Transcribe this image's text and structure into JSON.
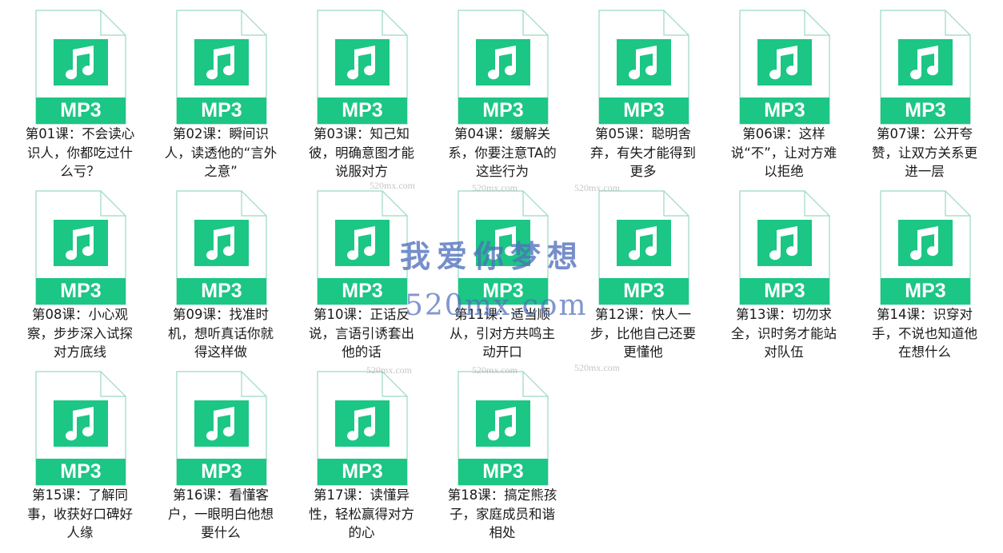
{
  "file_type_label": "MP3",
  "colors": {
    "accent": "#1cc685",
    "border": "#9ad9c0",
    "page_fill": "#ffffff"
  },
  "icon_name": "music-note-icon",
  "files": [
    {
      "name": "第01课：不会读心识人，你都吃过什么亏？"
    },
    {
      "name": "第02课：瞬间识人，读透他的“言外之意”"
    },
    {
      "name": "第03课：知己知彼，明确意图才能说服对方"
    },
    {
      "name": "第04课：缓解关系，你要注意TA的这些行为"
    },
    {
      "name": "第05课：聪明舍弃，有失才能得到更多"
    },
    {
      "name": "第06课：这样说“不”，让对方难以拒绝"
    },
    {
      "name": "第07课：公开夸赞，让双方关系更进一层"
    },
    {
      "name": "第08课：小心观察，步步深入试探对方底线"
    },
    {
      "name": "第09课：找准时机，想听真话你就得这样做"
    },
    {
      "name": "第10课：正话反说，言语引诱套出他的话"
    },
    {
      "name": "第11课：适当顺从，引对方共鸣主动开口"
    },
    {
      "name": "第12课：快人一步，比他自己还要更懂他"
    },
    {
      "name": "第13课：切勿求全，识时务才能站对队伍"
    },
    {
      "name": "第14课：识穿对手，不说也知道他在想什么"
    },
    {
      "name": "第15课：了解同事，收获好口碑好人缘"
    },
    {
      "name": "第16课：看懂客户，一眼明白他想要什么"
    },
    {
      "name": "第17课：读懂异性，轻松赢得对方的心"
    },
    {
      "name": "第18课：搞定熊孩子，家庭成员和谐相处"
    }
  ],
  "watermark": {
    "main": "我爱你梦想",
    "domain": "520mx.com",
    "small": "520mx.com"
  }
}
